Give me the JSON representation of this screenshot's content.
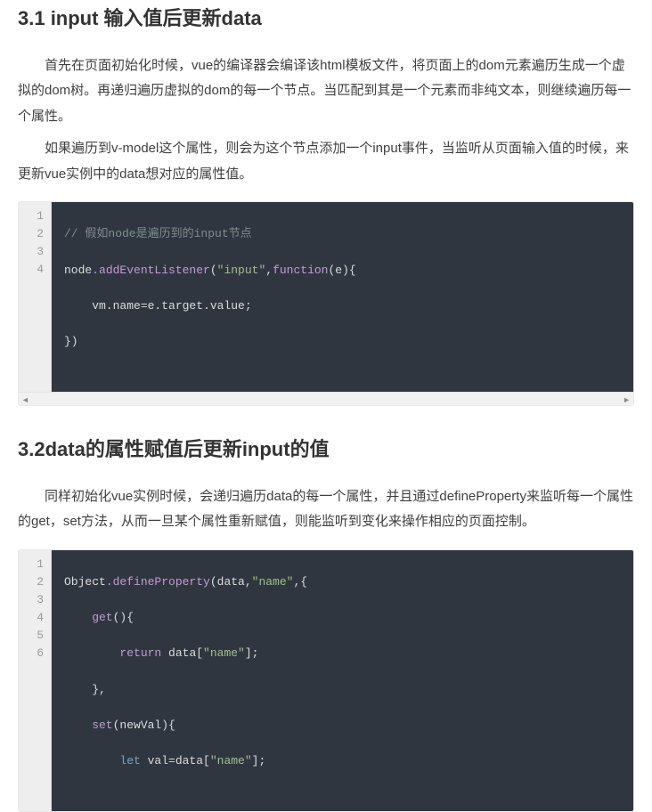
{
  "section1": {
    "heading": "3.1 input 输入值后更新data",
    "para1": "首先在页面初始化时候，vue的编译器会编译该html模板文件，将页面上的dom元素遍历生成一个虚拟的dom树。再递归遍历虚拟的dom的每一个节点。当匹配到其是一个元素而非纯文本，则继续遍历每一个属性。",
    "para2": "如果遍历到v-model这个属性，则会为这个节点添加一个input事件，当监听从页面输入值的时候，来更新vue实例中的data想对应的属性值。"
  },
  "code1": {
    "lines": [
      "1",
      "2",
      "3",
      "4"
    ],
    "l1_comment": "// 假如node是遍历到的input节点",
    "l2_a": "node",
    "l2_b": ".addEventListener",
    "l2_c": "(",
    "l2_d": "\"input\"",
    "l2_e": ",",
    "l2_f": "function",
    "l2_g": "(e){",
    "l3": "    vm.name=e.target.value;",
    "l4": "})"
  },
  "section2": {
    "heading": "3.2data的属性赋值后更新input的值",
    "para1": "同样初始化vue实例时候，会递归遍历data的每一个属性，并且通过defineProperty来监听每一个属性的get，set方法，从而一旦某个属性重新赋值，则能监听到变化来操作相应的页面控制。"
  },
  "code2": {
    "lines": [
      "1",
      "2",
      "3",
      "4",
      "5",
      "6"
    ],
    "l1_a": "Object",
    "l1_b": ".defineProperty",
    "l1_c": "(data,",
    "l1_d": "\"name\"",
    "l1_e": ",{",
    "l2_a": "    get",
    "l2_b": "(){",
    "l3_a": "        ",
    "l3_b": "return",
    "l3_c": " data[",
    "l3_d": "\"name\"",
    "l3_e": "];",
    "l4": "    },",
    "l5_a": "    set",
    "l5_b": "(newVal){",
    "l6_a": "        ",
    "l6_b": "let",
    "l6_c": " val=data[",
    "l6_d": "\"name\"",
    "l6_e": "];"
  }
}
